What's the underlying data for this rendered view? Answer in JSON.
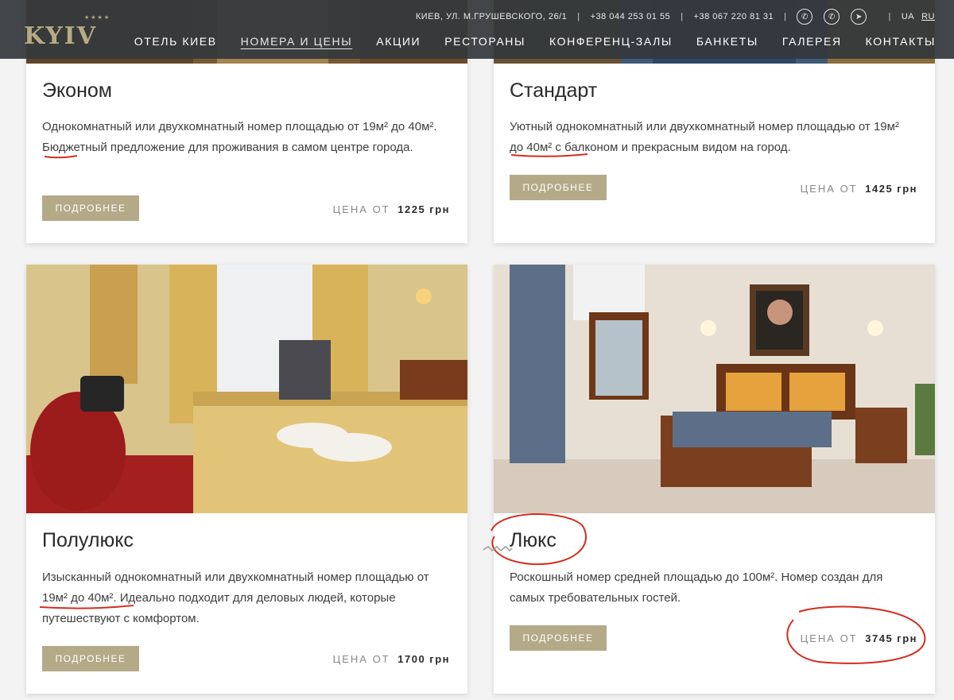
{
  "header": {
    "logo": "KYIV",
    "address": "КИЕВ, УЛ. М.ГРУШЕВСКОГО, 26/1",
    "phone1": "+38 044 253 01 55",
    "phone2": "+38 067 220 81 31",
    "social_icons": [
      "viber-icon",
      "whatsapp-icon",
      "telegram-icon"
    ],
    "lang_ua": "UA",
    "lang_ru": "RU",
    "nav": [
      "ОТЕЛЬ КИЕВ",
      "НОМЕРА И ЦЕНЫ",
      "АКЦИИ",
      "РЕСТОРАНЫ",
      "КОНФЕРЕНЦ-ЗАЛЫ",
      "БАНКЕТЫ",
      "ГАЛЕРЕЯ",
      "КОНТАКТЫ"
    ],
    "active_nav": "НОМЕРА И ЦЕНЫ"
  },
  "rooms": [
    {
      "title": "Эконом",
      "desc": "Однокомнатный или двухкомнатный номер площадью от 19м² до 40м². Бюджетный предложение для проживания в самом центре города.",
      "button": "ПОДРОБНЕЕ",
      "price_label": "ЦЕНА ОТ",
      "price": "1225 грн"
    },
    {
      "title": "Стандарт",
      "desc": "Уютный однокомнатный или двухкомнатный номер площадью от 19м² до 40м² с балконом и прекрасным видом на город.",
      "button": "ПОДРОБНЕЕ",
      "price_label": "ЦЕНА ОТ",
      "price": "1425 грн"
    },
    {
      "title": "Полулюкс",
      "desc": "Изысканный однокомнатный или двухкомнатный номер площадью от 19м² до 40м². Идеально подходит для деловых людей, которые путешествуют с комфортом.",
      "button": "ПОДРОБНЕЕ",
      "price_label": "ЦЕНА ОТ",
      "price": "1700 грн"
    },
    {
      "title": "Люкс",
      "desc": "Роскошный номер средней площадью до 100м². Номер создан для самых требовательных гостей.",
      "button": "ПОДРОБНЕЕ",
      "price_label": "ЦЕНА ОТ",
      "price": "3745 грн"
    }
  ],
  "colors": {
    "accent": "#b4aa88",
    "header_bg": "#34383c",
    "annotation_red": "#d32d20"
  }
}
